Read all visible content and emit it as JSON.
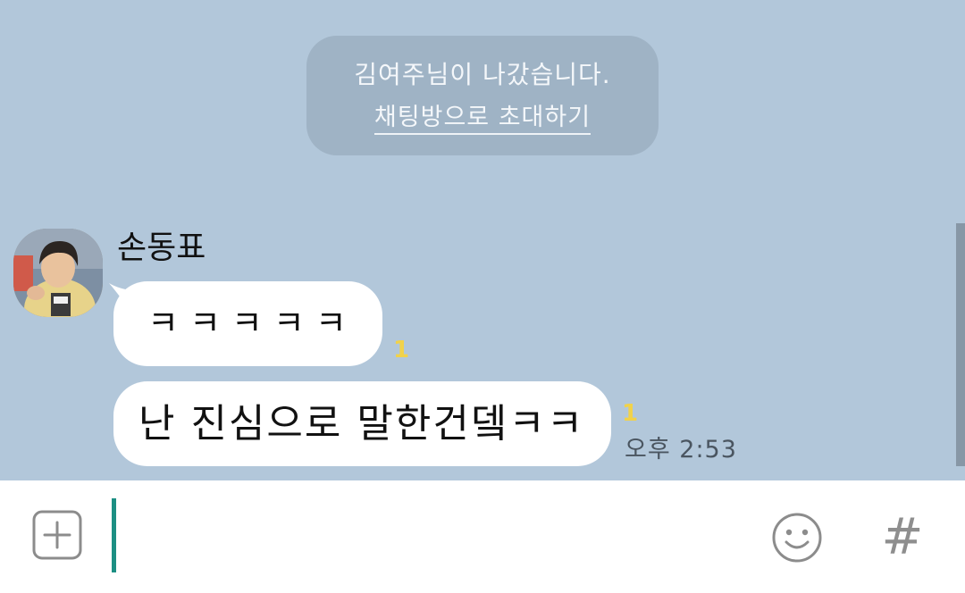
{
  "system_notice": {
    "text": "김여주님이 나갔습니다.",
    "invite_link": "채팅방으로 초대하기"
  },
  "message_group": {
    "sender_name": "손동표",
    "messages": [
      {
        "text": "ㅋㅋㅋㅋㅋ",
        "unread_count": "1"
      },
      {
        "text": "난 진심으로 말한건뎈ㅋㅋ",
        "unread_count": "1",
        "time": "오후 2:53"
      }
    ]
  },
  "input_bar": {
    "value": "",
    "attach_icon": "plus-square-icon",
    "emoji_icon": "smile-emoji-icon",
    "hash_icon": "#"
  },
  "colors": {
    "chat_background": "#b2c7da",
    "notice_background": "#9fb3c5",
    "bubble": "#ffffff",
    "unread": "#f1d24a",
    "cursor": "#1c8f83",
    "input_bar": "#ffffff"
  }
}
